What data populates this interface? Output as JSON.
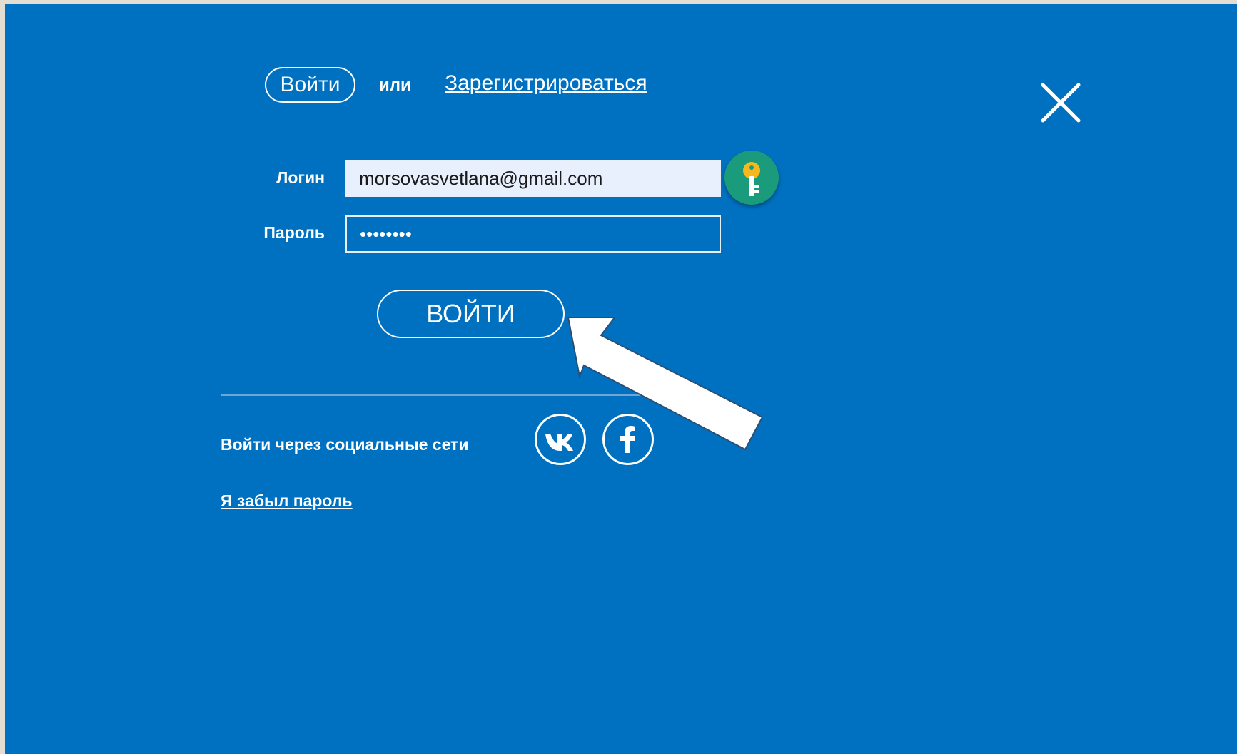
{
  "tabs": {
    "login_label": "Войти",
    "or_label": "или",
    "register_label": "Зарегистрироваться"
  },
  "form": {
    "login_label": "Логин",
    "login_value": "morsovasvetlana@gmail.com",
    "password_label": "Пароль",
    "password_value": "••••••••",
    "submit_label": "ВОЙТИ"
  },
  "social": {
    "label": "Войти через социальные сети",
    "vk_icon": "vk-icon",
    "fb_icon": "facebook-icon"
  },
  "forgot_label": "Я забыл пароль",
  "icons": {
    "close": "close-icon",
    "key": "key-icon",
    "arrow": "pointer-arrow-icon"
  },
  "colors": {
    "background": "#0071c1",
    "key_button": "#1a9b7c",
    "key": "#f6b81c",
    "login_field": "#e8f0fe"
  }
}
